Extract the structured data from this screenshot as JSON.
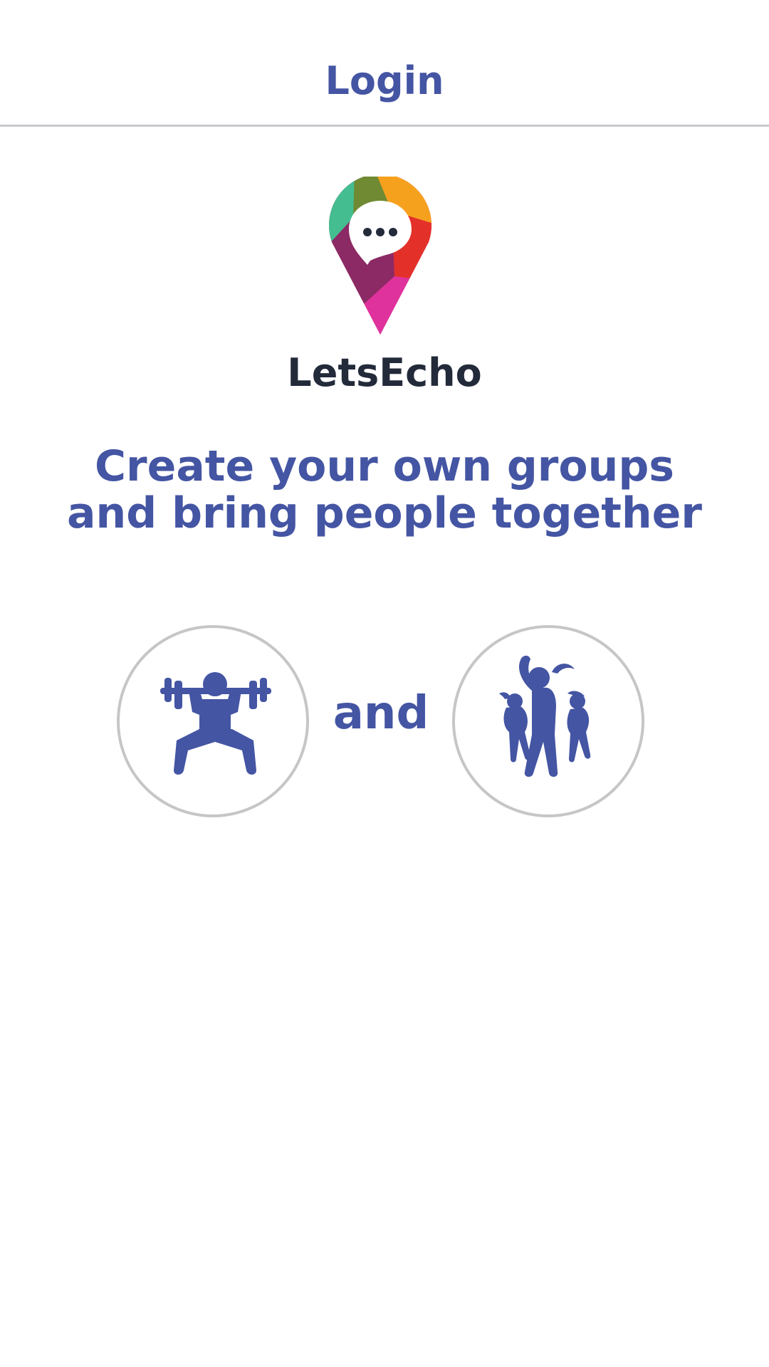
{
  "header": {
    "title": "Login"
  },
  "app": {
    "name": "LetsEcho",
    "logo_icon": "location-pin-chat-icon"
  },
  "tagline": {
    "line1": "Create your own groups",
    "line2": "and bring people together"
  },
  "activities": {
    "left_icon": "weightlifting-icon",
    "connector": "and",
    "right_icon": "group-exercise-icon"
  },
  "colors": {
    "accent": "#4455a3",
    "app_name": "#232a3a",
    "divider": "#c8c8cc",
    "circle_border": "#c6c6c6"
  }
}
